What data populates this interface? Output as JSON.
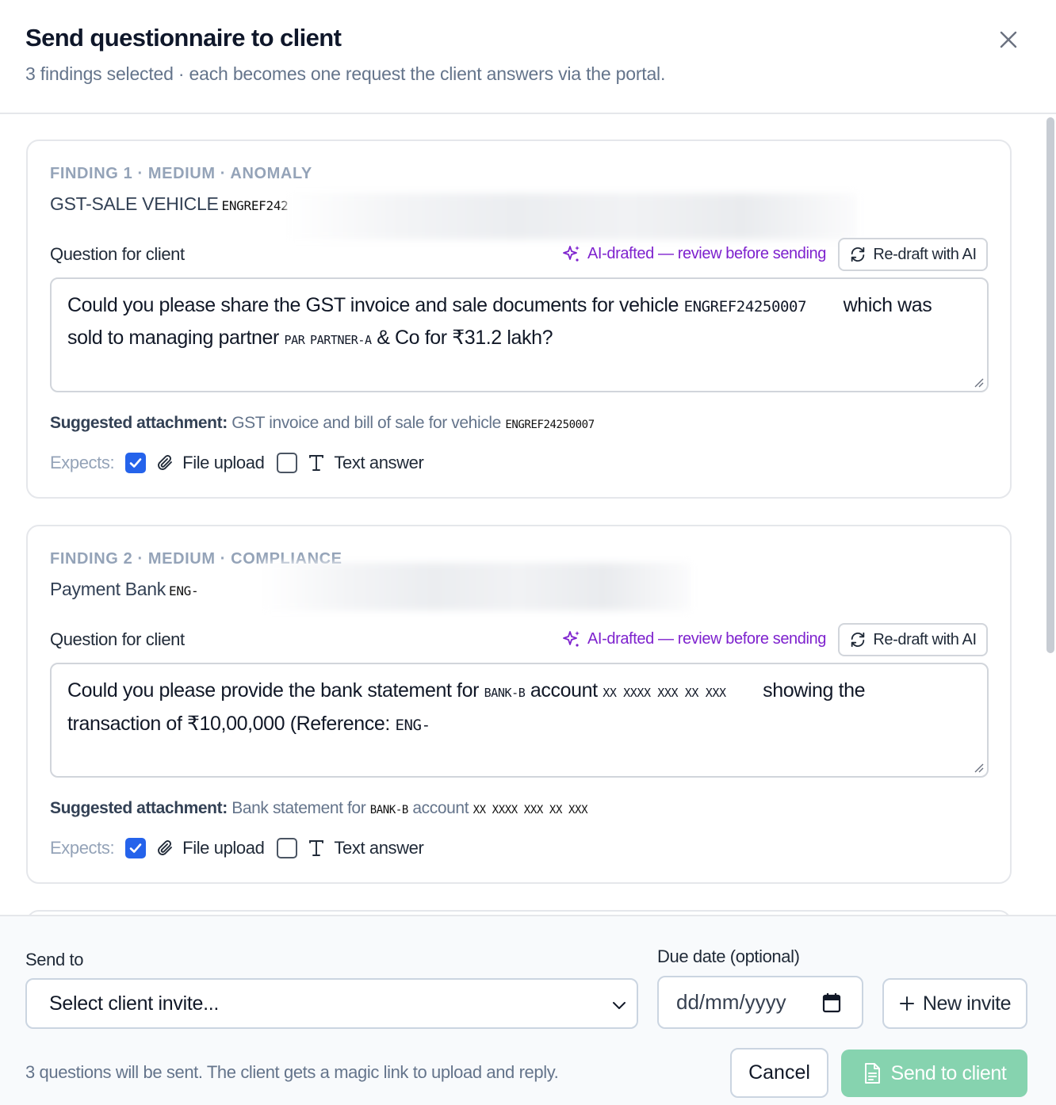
{
  "dialog": {
    "title": "Send questionnaire to client",
    "subtitle": "3 findings selected · each becomes one request the client answers via the portal."
  },
  "colors": {
    "accent_ai": "#7e22ce",
    "checkbox_checked": "#2563eb",
    "send_button": "#86d3af"
  },
  "findings": [
    {
      "label": "FINDING 1 · MEDIUM · ANOMALY",
      "title": "GST-SALE VEHICLE",
      "ref": "ENGREF242",
      "question_label": "Question for client",
      "ai_badge": "AI-drafted — review before sending",
      "redraft_label": "Re-draft with AI",
      "question": {
        "part1": "Could you please share the GST invoice and sale documents for vehicle",
        "ref": "ENGREF24250007",
        "part2": "which was",
        "part3": "sold to managing partner",
        "partner_a": "PAR",
        "partner_b": "PARTNER-A",
        "part4": "& Co for ₹31.2 lakh?"
      },
      "attachment_label": "Suggested attachment:",
      "attachment_text": "GST invoice and bill of sale for vehicle",
      "attachment_ref": "ENGREF24250007",
      "expects_label": "Expects:",
      "file_upload_label": "File upload",
      "file_upload_checked": true,
      "text_answer_label": "Text answer",
      "text_answer_checked": false
    },
    {
      "label": "FINDING 2 · MEDIUM · COMPLIANCE",
      "title": "Payment Bank",
      "ref": "ENG-",
      "question_label": "Question for client",
      "ai_badge": "AI-drafted — review before sending",
      "redraft_label": "Re-draft with AI",
      "question": {
        "part1": "Could you please provide the bank statement for",
        "bank": "BANK-B",
        "part2": "account",
        "account": "XX XXXX XXX XX XXX",
        "part3": "showing the",
        "part4": "transaction of ₹10,00,000 (Reference:",
        "ref": "ENG-"
      },
      "attachment_label": "Suggested attachment:",
      "attachment_text": "Bank statement for",
      "attachment_bank": "BANK-B",
      "attachment_text2": "account",
      "attachment_account": "XX XXXX XXX XX XXX",
      "expects_label": "Expects:",
      "file_upload_label": "File upload",
      "file_upload_checked": true,
      "text_answer_label": "Text answer",
      "text_answer_checked": false
    }
  ],
  "footer": {
    "send_to_label": "Send to",
    "send_to_value": "Select client invite...",
    "due_date_label": "Due date (optional)",
    "due_date_placeholder": "dd/mm/yyyy",
    "new_invite_label": "New invite",
    "note": "3 questions will be sent. The client gets a magic link to upload and reply.",
    "cancel_label": "Cancel",
    "send_label": "Send to client"
  }
}
